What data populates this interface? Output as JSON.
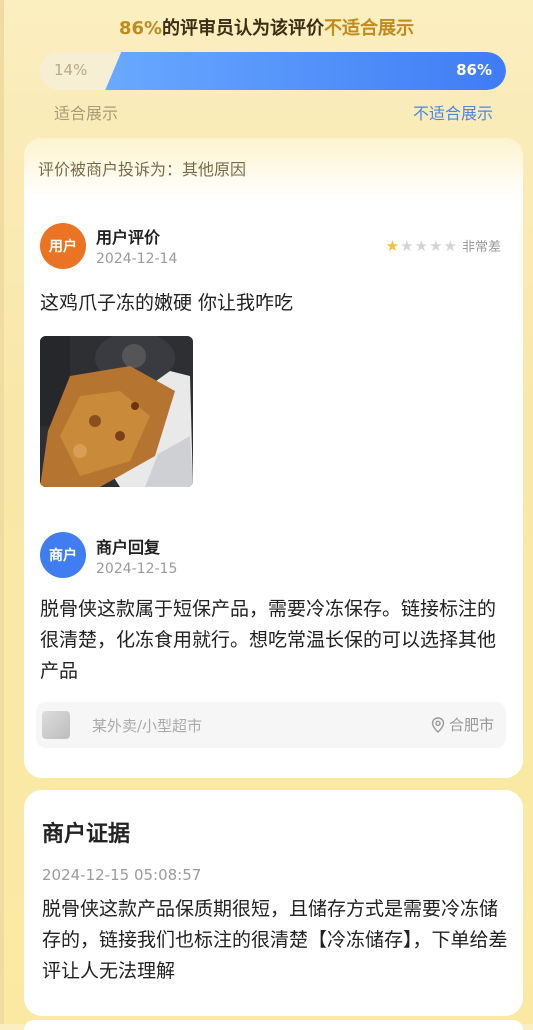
{
  "header": {
    "percent": "86%",
    "title_mid": "的评审员认为该评价",
    "title_highlight": "不适合展示"
  },
  "vote_bar": {
    "left_value": "14%",
    "right_value": "86%",
    "left_fraction": 0.14,
    "right_fraction": 0.86,
    "left_caption": "适合展示",
    "right_caption": "不适合展示"
  },
  "complaint": {
    "reason": "评价被商户投诉为：其他原因"
  },
  "user_review": {
    "avatar_label": "用户",
    "author": "用户评价",
    "date": "2024-12-14",
    "rating_stars": 1,
    "rating_max": 5,
    "rating_text": "非常差",
    "text": "这鸡爪子冻的嫩硬 你让我咋吃"
  },
  "merchant_reply": {
    "avatar_label": "商户",
    "author": "商户回复",
    "date": "2024-12-15",
    "text": "脱骨侠这款属于短保产品，需要冷冻保存。链接标注的很清楚，化冻食用就行。想吃常温长保的可以选择其他产品"
  },
  "shop": {
    "name": "某外卖/小型超市",
    "location": "合肥市"
  },
  "evidence": {
    "title": "商户证据",
    "date": "2024-12-15 05:08:57",
    "text": "脱骨侠这款产品保质期很短，且储存方式是需要冷冻储存的，链接我们也标注的很清楚【冷冻储存】，下单给差评让人无法理解"
  },
  "colors": {
    "user_avatar": "#ea7423",
    "merchant_avatar": "#3f7df0",
    "bar_fill": "#3f7cf5",
    "highlight": "#c08a1d"
  }
}
